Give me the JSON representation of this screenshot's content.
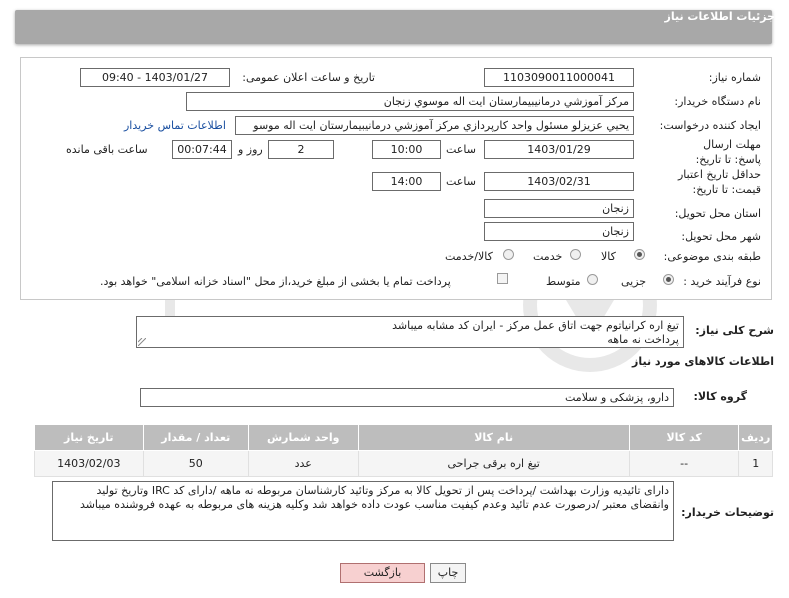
{
  "header": {
    "title": "جزئیات اطلاعات نیاز"
  },
  "fields": {
    "need_number": {
      "label": "شماره نیاز:",
      "value": "1103090011000041"
    },
    "announce": {
      "label": "تاریخ و ساعت اعلان عمومی:",
      "value": "1403/01/27 - 09:40"
    },
    "buyer_org": {
      "label": "نام دستگاه خریدار:",
      "value": "مرکز آموزشي درمانيبيمارستان ايت اله موسوي زنجان"
    },
    "creator": {
      "label": "ایجاد کننده درخواست:",
      "value": "يحيي عزيزلو مسئول واحد کارپردازي مرکز آموزشي درمانيبيمارستان ايت اله موسو",
      "contact_link": "اطلاعات تماس خریدار"
    },
    "reply_deadline": {
      "label": "مهلت ارسال پاسخ: تا تاریخ:",
      "date": "1403/01/29",
      "time_label": "ساعت",
      "time": "10:00",
      "days": "2",
      "days_label": "روز و",
      "remaining": "00:07:44",
      "remaining_label": "ساعت باقی مانده"
    },
    "price_validity": {
      "label": "حداقل تاریخ اعتبار قیمت: تا تاریخ:",
      "date": "1403/02/31",
      "time_label": "ساعت",
      "time": "14:00"
    },
    "province": {
      "label": "استان محل تحویل:",
      "value": "زنجان"
    },
    "city": {
      "label": "شهر محل تحویل:",
      "value": "زنجان"
    },
    "category": {
      "label": "طبقه بندی موضوعی:",
      "options": [
        {
          "label": "کالا",
          "checked": true
        },
        {
          "label": "خدمت",
          "checked": false
        },
        {
          "label": "کالا/خدمت",
          "checked": false
        }
      ]
    },
    "purchase_type": {
      "label": "نوع فرآیند خرید :",
      "options": [
        {
          "label": "جزیی",
          "checked": true
        },
        {
          "label": "متوسط",
          "checked": false
        }
      ],
      "payment_note": "پرداخت تمام یا بخشی از مبلغ خرید،از محل \"اسناد خزانه اسلامی\" خواهد بود."
    }
  },
  "description": {
    "label": "شرح کلی نیاز:",
    "line1": "تیغ اره کرانیاتوم جهت اتاق عمل مرکز  - ایران کد مشابه میباشد",
    "line2": "پرداخت نه ماهه"
  },
  "goods_info": {
    "title": "اطلاعات کالاهای مورد نیاز"
  },
  "goods_group": {
    "label": "گروه کالا:",
    "value": "دارو، پزشکی و سلامت"
  },
  "table": {
    "headers": [
      "ردیف",
      "کد کالا",
      "نام کالا",
      "واحد شمارش",
      "تعداد / مقدار",
      "تاریخ نیاز"
    ],
    "rows": [
      [
        "1",
        "--",
        "تیغ اره برقی جراحی",
        "عدد",
        "50",
        "1403/02/03"
      ]
    ]
  },
  "buyer_notes": {
    "label": "توضیحات خریدار:",
    "text": "دارای تائیدیه وزارت بهداشت /پرداخت پس از تحویل کالا به مرکز وتائید کارشناسان مربوطه نه ماهه  /دارای کد IRC  وتاریخ تولید وانقضای معتبر /درصورت عدم تائید وعدم کیفیت مناسب عودت داده خواهد شد وکلیه هزینه های مربوطه به عهده فروشنده میباشد"
  },
  "buttons": {
    "print": "چاپ",
    "back": "بازگشت"
  }
}
